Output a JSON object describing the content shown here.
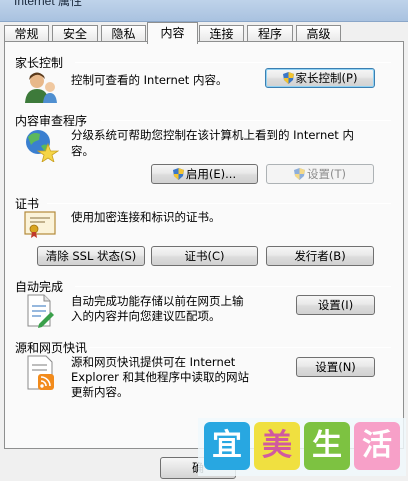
{
  "window": {
    "title": "Internet 属性"
  },
  "tabs": [
    {
      "label": "常规"
    },
    {
      "label": "安全"
    },
    {
      "label": "隐私"
    },
    {
      "label": "内容"
    },
    {
      "label": "连接"
    },
    {
      "label": "程序"
    },
    {
      "label": "高级"
    }
  ],
  "parental": {
    "title": "家长控制",
    "desc": "控制可查看的 Internet 内容。",
    "button": "家长控制(P)"
  },
  "advisor": {
    "title": "内容审查程序",
    "desc_line1": "分级系统可帮助您控制在该计算机上看到的 Internet 内",
    "desc_line2": "容。",
    "enable_button": "启用(E)...",
    "settings_button": "设置(T)"
  },
  "certificates": {
    "title": "证书",
    "desc": "使用加密连接和标识的证书。",
    "clear_ssl_button": "清除 SSL 状态(S)",
    "certs_button": "证书(C)",
    "publishers_button": "发行者(B)"
  },
  "autocomplete": {
    "title": "自动完成",
    "desc_line1": "自动完成功能存储以前在网页上输",
    "desc_line2": "入的内容并向您建议匹配项。",
    "settings_button": "设置(I)"
  },
  "feeds": {
    "title": "源和网页快讯",
    "desc_line1": "源和网页快讯提供可在 Internet",
    "desc_line2": "Explorer 和其他程序中读取的网站",
    "desc_line3": "更新内容。",
    "settings_button": "设置(N)"
  },
  "footer": {
    "ok_button": "确"
  },
  "watermark": {
    "chars": [
      "宜",
      "美",
      "生",
      "活"
    ]
  }
}
